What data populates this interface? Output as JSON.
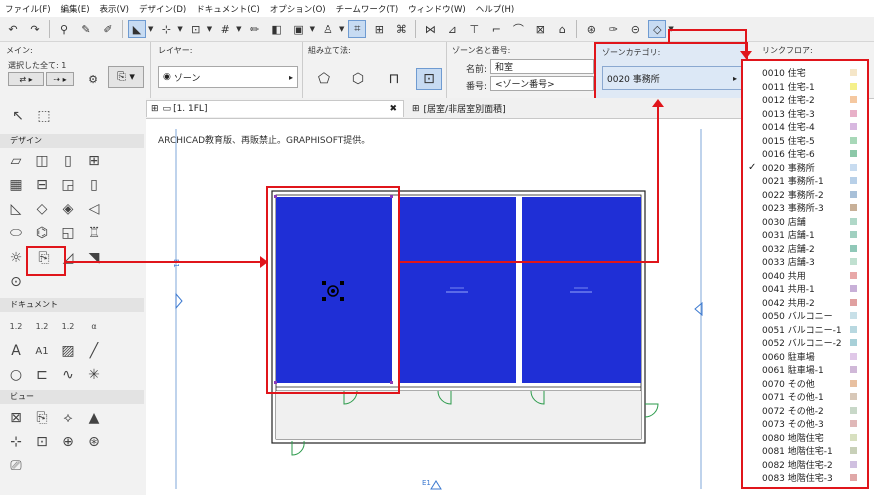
{
  "menu": [
    "ファイル(F)",
    "編集(E)",
    "表示(V)",
    "デザイン(D)",
    "ドキュメント(C)",
    "オプション(O)",
    "チームワーク(T)",
    "ウィンドウ(W)",
    "ヘルプ(H)"
  ],
  "infobox": {
    "main_label": "メイン:",
    "selected_all": "選択した全て: 1",
    "layer_label": "レイヤー:",
    "layer_value": "ゾーン",
    "construction_label": "組み立て法:",
    "zone_name_number_label": "ゾーン名と番号:",
    "name_label": "名前:",
    "name_value": "和室",
    "number_label": "番号:",
    "number_value": "<ゾーン番号>",
    "zone_category_label": "ゾーンカテゴリ:",
    "zone_category_value": "0020 事務所",
    "link_floor_label": "リンクフロア:"
  },
  "toolbox": {
    "design_label": "デザイン",
    "document_label": "ドキュメント",
    "view_label": "ビュー",
    "document_tools": [
      "1.2",
      "1.2",
      "1.2",
      "α"
    ],
    "text_tool": "A",
    "label_tool": "A1"
  },
  "tabs": {
    "tab1": "[1. 1FL]",
    "tab2": "[居室/非居室別面積]"
  },
  "canvas": {
    "watermark": "ARCHICAD教育版、再販禁止。GRAPHISOFT提供。",
    "marker_left": "E1",
    "marker_bottom": "E1"
  },
  "categories": [
    {
      "label": "0010 住宅",
      "color": "#f5e6c8",
      "checked": false
    },
    {
      "label": "0011 住宅-1",
      "color": "#f5f08a",
      "checked": false
    },
    {
      "label": "0012 住宅-2",
      "color": "#f5c8a0",
      "checked": false
    },
    {
      "label": "0013 住宅-3",
      "color": "#e8b0c8",
      "checked": false
    },
    {
      "label": "0014 住宅-4",
      "color": "#d8b8e0",
      "checked": false
    },
    {
      "label": "0015 住宅-5",
      "color": "#a8d8b8",
      "checked": false
    },
    {
      "label": "0016 住宅-6",
      "color": "#8cc8a8",
      "checked": false
    },
    {
      "label": "0020 事務所",
      "color": "#c8dcf0",
      "checked": true
    },
    {
      "label": "0021 事務所-1",
      "color": "#b8d0e8",
      "checked": false
    },
    {
      "label": "0022 事務所-2",
      "color": "#a8c0d8",
      "checked": false
    },
    {
      "label": "0023 事務所-3",
      "color": "#c8b098",
      "checked": false
    },
    {
      "label": "0030 店舗",
      "color": "#b0d8c8",
      "checked": false
    },
    {
      "label": "0031 店舗-1",
      "color": "#a0d0c0",
      "checked": false
    },
    {
      "label": "0032 店舗-2",
      "color": "#90c8b8",
      "checked": false
    },
    {
      "label": "0033 店舗-3",
      "color": "#c0e0d0",
      "checked": false
    },
    {
      "label": "0040 共用",
      "color": "#e8a8a8",
      "checked": false
    },
    {
      "label": "0041 共用-1",
      "color": "#c8b0d8",
      "checked": false
    },
    {
      "label": "0042 共用-2",
      "color": "#e0a0a0",
      "checked": false
    },
    {
      "label": "0050 バルコニー",
      "color": "#c8e0e8",
      "checked": false
    },
    {
      "label": "0051 バルコニー-1",
      "color": "#b8d8e0",
      "checked": false
    },
    {
      "label": "0052 バルコニー-2",
      "color": "#a8d0d8",
      "checked": false
    },
    {
      "label": "0060 駐車場",
      "color": "#e0c8e8",
      "checked": false
    },
    {
      "label": "0061 駐車場-1",
      "color": "#d0b8d8",
      "checked": false
    },
    {
      "label": "0070 その他",
      "color": "#e8c0a0",
      "checked": false
    },
    {
      "label": "0071 その他-1",
      "color": "#d8c8b8",
      "checked": false
    },
    {
      "label": "0072 その他-2",
      "color": "#c8d8c8",
      "checked": false
    },
    {
      "label": "0073 その他-3",
      "color": "#e0b8b8",
      "checked": false
    },
    {
      "label": "0080 地階住宅",
      "color": "#d8e0c0",
      "checked": false
    },
    {
      "label": "0081 地階住宅-1",
      "color": "#c8d0b8",
      "checked": false
    },
    {
      "label": "0082 地階住宅-2",
      "color": "#d0c0e0",
      "checked": false
    },
    {
      "label": "0083 地階住宅-3",
      "color": "#e0a8a8",
      "checked": false
    }
  ],
  "colors": {
    "zone_fill": "#1f2fd6",
    "highlight": "#e0151b"
  }
}
